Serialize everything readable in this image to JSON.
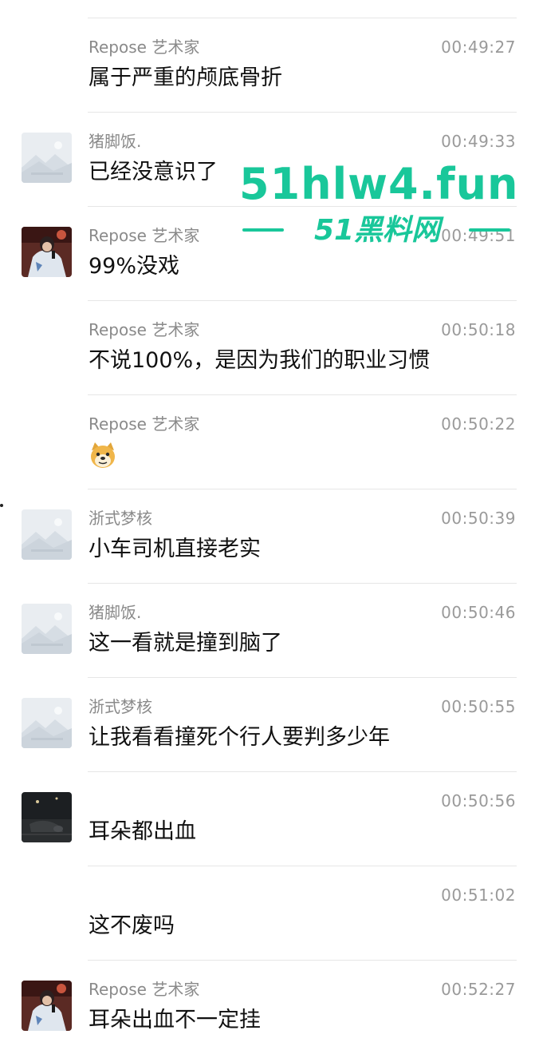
{
  "messages": [
    {
      "sender": "Repose 艺术家",
      "time": "00:49:27",
      "text": "属于严重的颅底骨折",
      "avatar": "none"
    },
    {
      "sender": "猪脚饭.",
      "time": "00:49:33",
      "text": "已经没意识了",
      "avatar": "placeholder-image-icon"
    },
    {
      "sender": "Repose 艺术家",
      "time": "00:49:51",
      "text": "99%没戏",
      "avatar": "user-photo-singer"
    },
    {
      "sender": "Repose 艺术家",
      "time": "00:50:18",
      "text": "不说100%，是因为我们的职业习惯",
      "avatar": "none"
    },
    {
      "sender": "Repose 艺术家",
      "time": "00:50:22",
      "text": "",
      "emoji": "doge-emoji-icon",
      "avatar": "none"
    },
    {
      "sender": "浙式梦核",
      "time": "00:50:39",
      "text": "小车司机直接老实",
      "avatar": "placeholder-image-icon"
    },
    {
      "sender": "猪脚饭.",
      "time": "00:50:46",
      "text": "这一看就是撞到脑了",
      "avatar": "placeholder-image-icon"
    },
    {
      "sender": "浙式梦核",
      "time": "00:50:55",
      "text": "让我看看撞死个行人要判多少年",
      "avatar": "placeholder-image-icon"
    },
    {
      "sender": "",
      "time": "00:50:56",
      "text": "耳朵都出血",
      "avatar": "user-photo-dark-street"
    },
    {
      "sender": "",
      "time": "00:51:02",
      "text": "这不废吗",
      "avatar": "none"
    },
    {
      "sender": "Repose 艺术家",
      "time": "00:52:27",
      "text": "耳朵出血不一定挂",
      "avatar": "user-photo-singer"
    }
  ],
  "watermark": {
    "domain": "51hlw4.fun",
    "subtitle": "51黑料网"
  },
  "colors": {
    "watermark": "#19c79a",
    "sender": "#8a8a8a",
    "time": "#9a9a9a",
    "divider": "#e6e6e6"
  }
}
